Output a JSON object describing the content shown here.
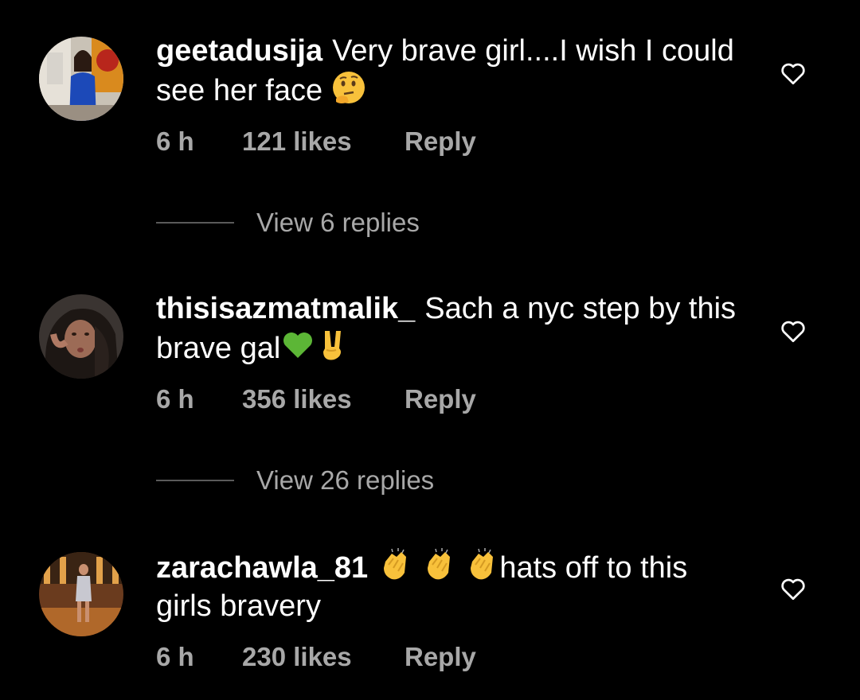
{
  "comments": [
    {
      "username": "geetadusija",
      "text": "Very brave girl....I wish I could see her face",
      "emoji": "thinking-face",
      "time": "6 h",
      "likes": "121 likes",
      "reply_label": "Reply",
      "view_replies": "View 6 replies"
    },
    {
      "username": "thisisazmatmalik_",
      "text": "Sach a nyc step by this brave gal",
      "emoji": "green-heart victory-hand",
      "time": "6 h",
      "likes": "356 likes",
      "reply_label": "Reply",
      "view_replies": "View 26 replies"
    },
    {
      "username": "zarachawla_81",
      "text_after_emoji": "hats off to this girls bravery",
      "emoji": "clapping-hands x3",
      "time": "6 h",
      "likes": "230 likes",
      "reply_label": "Reply"
    }
  ],
  "colors": {
    "background": "#000000",
    "primary_text": "#ffffff",
    "secondary_text": "#a8a8a8",
    "divider": "#5a5a5a"
  },
  "icons": {
    "like": "heart-outline-icon"
  }
}
